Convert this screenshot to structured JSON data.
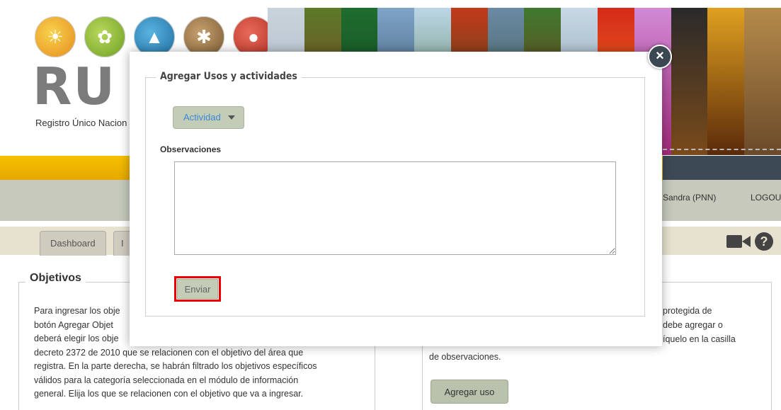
{
  "brand": {
    "acronym": "RU",
    "subtitle": "Registro Único Nacion"
  },
  "header": {
    "user": "Sandra (PNN)",
    "logout": "LOGOUT"
  },
  "tabs": [
    {
      "label": "Dashboard"
    },
    {
      "label": "I"
    }
  ],
  "objetivos": {
    "title": "Objetivos",
    "lines": [
      "Para ingresar los obje",
      "botón Agregar Objet",
      "deberá elegir los obje",
      "decreto 2372 de 2010 que se relacionen con el objetivo del área que",
      "registra. En la parte derecha, se habrán filtrado los objetivos específicos",
      "válidos para la categoría seleccionada en el módulo de información",
      "general. Elija los que se relacionen con el objetivo que va a ingresar."
    ]
  },
  "usos": {
    "lines": [
      "protegida de",
      "debe agregar o",
      "íquelo en la casilla",
      "de observaciones."
    ],
    "add_button": "Agregar uso"
  },
  "modal": {
    "legend": "Agregar Usos y actividades",
    "dropdown_label": "Actividad",
    "observaciones_label": "Observaciones",
    "observaciones_value": "",
    "submit_label": "Enviar",
    "close_glyph": "×"
  },
  "icons": {
    "video": "video-camera-icon",
    "help": "help-icon",
    "help_glyph": "?"
  },
  "colors": {
    "yellow_bar": "#f6c000",
    "dark_bar": "#3d4a55",
    "button_bg": "#c3ccb6",
    "dropdown_text": "#3a8ad6",
    "highlight": "#e00000"
  }
}
